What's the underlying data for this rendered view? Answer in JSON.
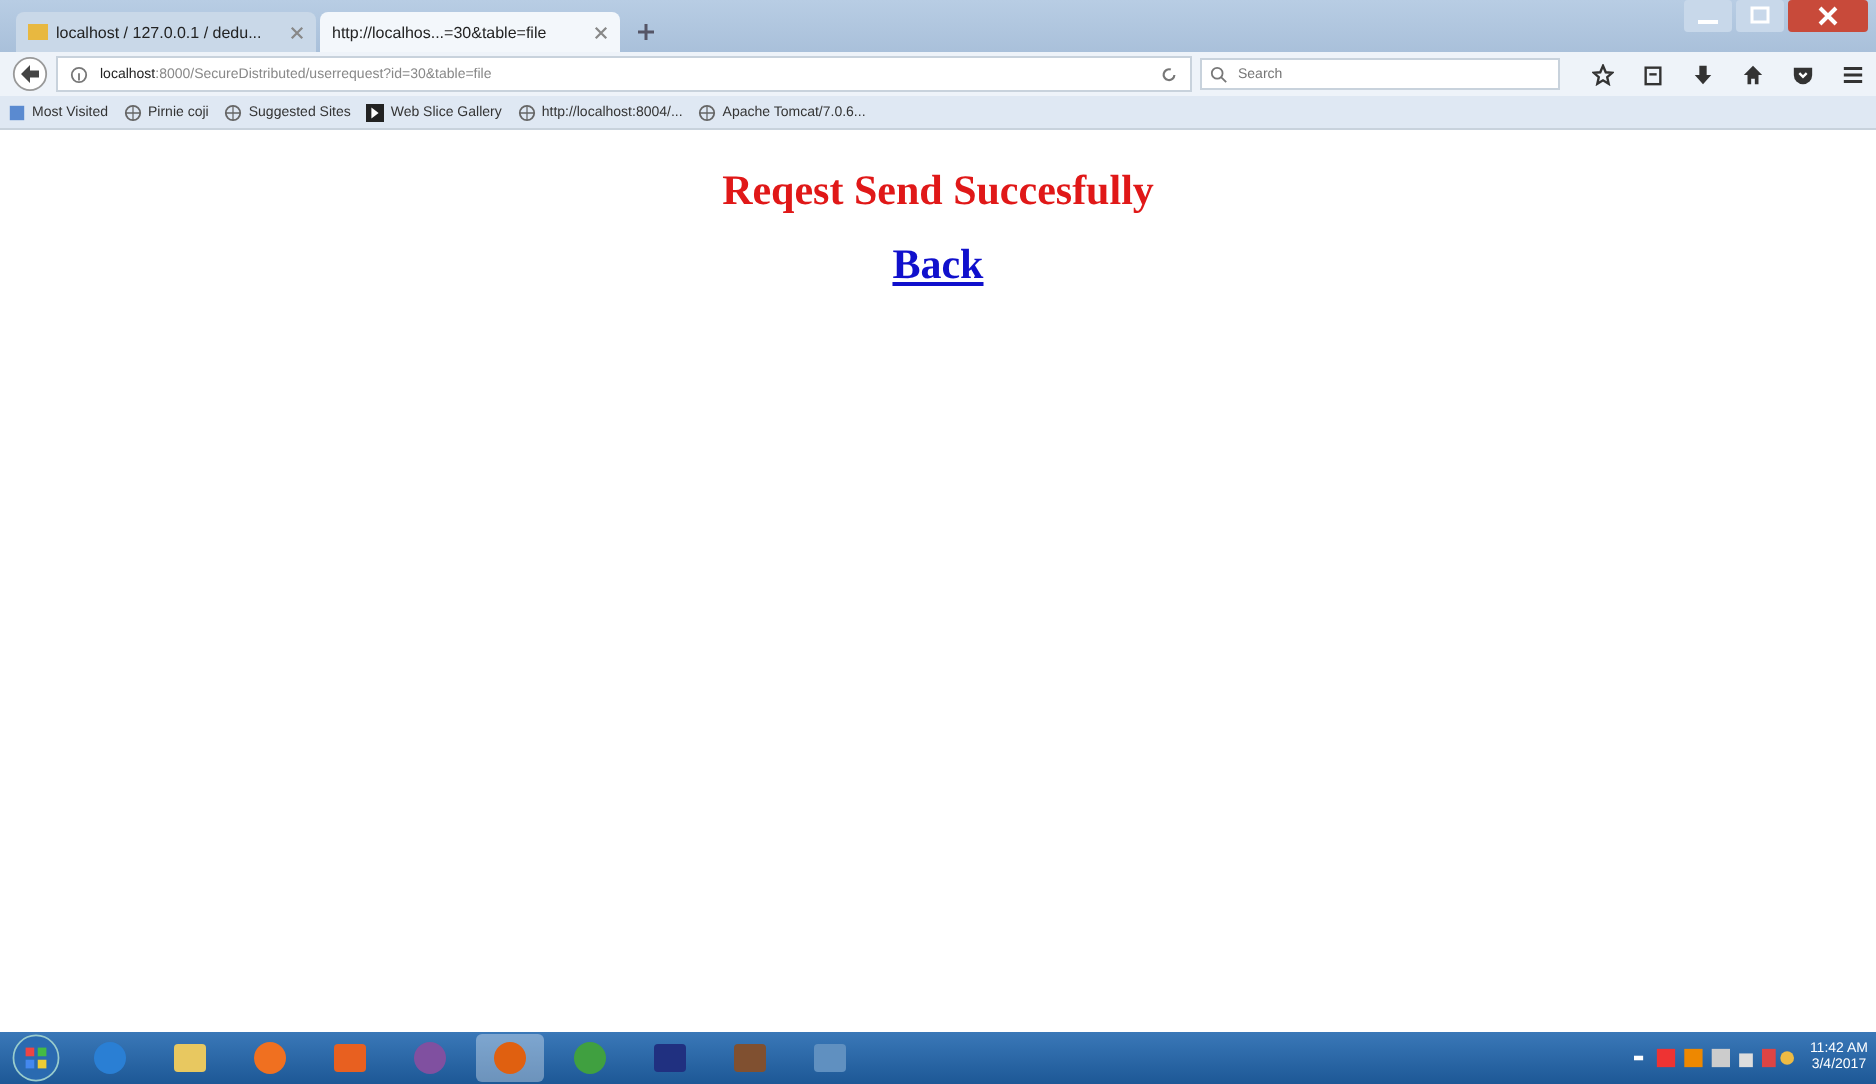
{
  "tabs": [
    {
      "label": "localhost / 127.0.0.1 / dedu...",
      "selected": false
    },
    {
      "label": "http://localhos...=30&table=file",
      "selected": true
    }
  ],
  "address": {
    "value_host": "localhost",
    "value_rest": ":8000/SecureDistributed/userrequest?id=30&table=file"
  },
  "search": {
    "placeholder": "Search"
  },
  "bookmarks": [
    "Most Visited",
    "Pirnie coji",
    "Suggested Sites",
    "Web Slice Gallery",
    "http://localhost:8004/...",
    "Apache Tomcat/7.0.6..."
  ],
  "page": {
    "message": "Reqest Send Succesfully",
    "link": "Back"
  },
  "taskbar": [
    {
      "kind": "ie",
      "selected": false
    },
    {
      "kind": "folder",
      "selected": false
    },
    {
      "kind": "media",
      "selected": false
    },
    {
      "kind": "xampp",
      "selected": false
    },
    {
      "kind": "orb",
      "selected": false
    },
    {
      "kind": "firefox",
      "selected": true
    },
    {
      "kind": "chrome",
      "selected": false
    },
    {
      "kind": "app",
      "selected": false
    },
    {
      "kind": "app2",
      "selected": false
    },
    {
      "kind": "doc",
      "selected": false
    }
  ],
  "clock": {
    "time": "11:42 AM",
    "date": "3/4/2017"
  }
}
